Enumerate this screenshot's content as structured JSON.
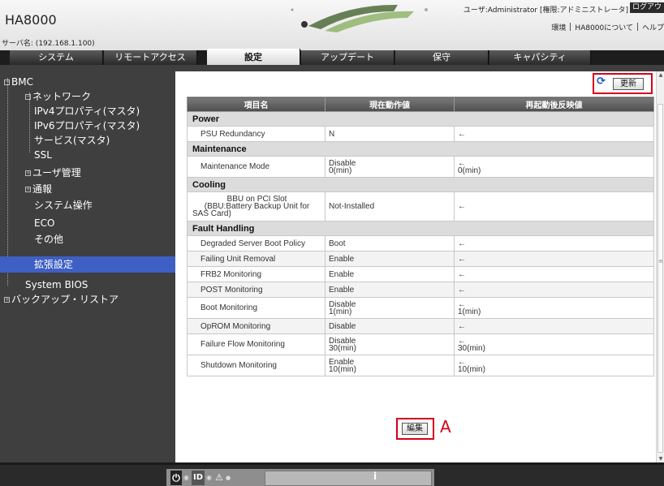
{
  "header": {
    "product": "HA8000",
    "server_name": "サーバ名: (192.168.1.100)",
    "user": "ユーザ:Administrator [権限:アドミニストレータ]",
    "logout": "ログアウト",
    "links": [
      "環境",
      "HA8000について",
      "ヘルプ"
    ]
  },
  "tabs": [
    {
      "label": "システム",
      "active": false
    },
    {
      "label": "リモートアクセス",
      "active": false
    },
    {
      "label": "設定",
      "active": true
    },
    {
      "label": "アップデート",
      "active": false
    },
    {
      "label": "保守",
      "active": false
    },
    {
      "label": "キャパシティ",
      "active": false
    }
  ],
  "sidebar": {
    "items": [
      {
        "label": "BMC",
        "expander": "−"
      },
      {
        "label": "ネットワーク",
        "expander": "−"
      },
      {
        "label": "IPv4プロパティ(マスタ)"
      },
      {
        "label": "IPv6プロパティ(マスタ)"
      },
      {
        "label": "サービス(マスタ)"
      },
      {
        "label": "SSL"
      },
      {
        "label": "ユーザ管理",
        "expander": "+"
      },
      {
        "label": "通報",
        "expander": "+"
      },
      {
        "label": "システム操作"
      },
      {
        "label": "ECO"
      },
      {
        "label": "その他"
      },
      {
        "label": "拡張設定",
        "selected": true
      },
      {
        "label": "System BIOS"
      },
      {
        "label": "バックアップ・リストア",
        "expander": "+"
      }
    ]
  },
  "toolbar": {
    "refresh": "更新"
  },
  "table": {
    "headers": [
      "項目名",
      "現在動作値",
      "再起動後反映値"
    ],
    "sections": [
      {
        "title": "Power",
        "rows": [
          {
            "item": "PSU Redundancy",
            "current": "N",
            "next": "←"
          }
        ]
      },
      {
        "title": "Maintenance",
        "rows": [
          {
            "item": "Maintenance Mode",
            "current": "Disable",
            "current2": "0(min)",
            "next": "←",
            "next2": "0(min)"
          }
        ]
      },
      {
        "title": "Cooling",
        "rows": [
          {
            "item": "BBU on PCI Slot",
            "item2": "(BBU:Battery Backup Unit for",
            "item3": "SAS Card)",
            "current": "Not-Installed",
            "next": "←"
          }
        ]
      },
      {
        "title": "Fault Handling",
        "rows": [
          {
            "item": "Degraded Server Boot Policy",
            "current": "Boot",
            "next": "←"
          },
          {
            "item": "Failing Unit Removal",
            "current": "Enable",
            "next": "←"
          },
          {
            "item": "FRB2 Monitoring",
            "current": "Enable",
            "next": "←"
          },
          {
            "item": "POST Monitoring",
            "current": "Enable",
            "next": "←"
          },
          {
            "item": "Boot Monitoring",
            "current": "Disable",
            "current2": "1(min)",
            "next": "←",
            "next2": "1(min)"
          },
          {
            "item": "OpROM Monitoring",
            "current": "Disable",
            "next": "←"
          },
          {
            "item": "Failure Flow Monitoring",
            "current": "Disable",
            "current2": "30(min)",
            "next": "←",
            "next2": "30(min)"
          },
          {
            "item": "Shutdown Monitoring",
            "current": "Enable",
            "current2": "10(min)",
            "next": "←",
            "next2": "10(min)"
          }
        ]
      }
    ]
  },
  "actions": {
    "edit": "編集"
  },
  "annotation": {
    "label": "A"
  },
  "footer": {
    "id_label": "ID",
    "info": "i"
  },
  "colors": {
    "accent_red": "#d6001c",
    "nav_selected": "#3e5fc4",
    "refresh_blue": "#1a4fd0"
  }
}
